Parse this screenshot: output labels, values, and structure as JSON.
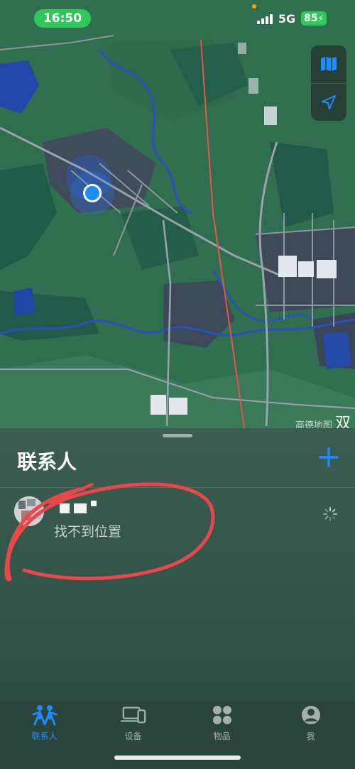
{
  "status_bar": {
    "time": "16:50",
    "network": "5G",
    "battery": "85"
  },
  "map": {
    "watermark": "高德地图",
    "edge_label": "双",
    "buttons": [
      {
        "icon": "map-icon"
      },
      {
        "icon": "location-arrow-icon"
      }
    ]
  },
  "sheet": {
    "title": "联系人",
    "add_icon": "plus-icon",
    "contacts": [
      {
        "name": "",
        "status": "找不到位置",
        "avatar_icon": "avatar-icon",
        "loading_icon": "spinner-icon"
      }
    ]
  },
  "tabs": [
    {
      "label": "联系人",
      "icon": "people-icon",
      "active": true
    },
    {
      "label": "设备",
      "icon": "devices-icon",
      "active": false
    },
    {
      "label": "物品",
      "icon": "items-grid-icon",
      "active": false
    },
    {
      "label": "我",
      "icon": "person-circle-icon",
      "active": false
    }
  ],
  "colors": {
    "accent": "#1e8bff",
    "status_green": "#30c85a",
    "annotation_red": "#e8484a"
  }
}
